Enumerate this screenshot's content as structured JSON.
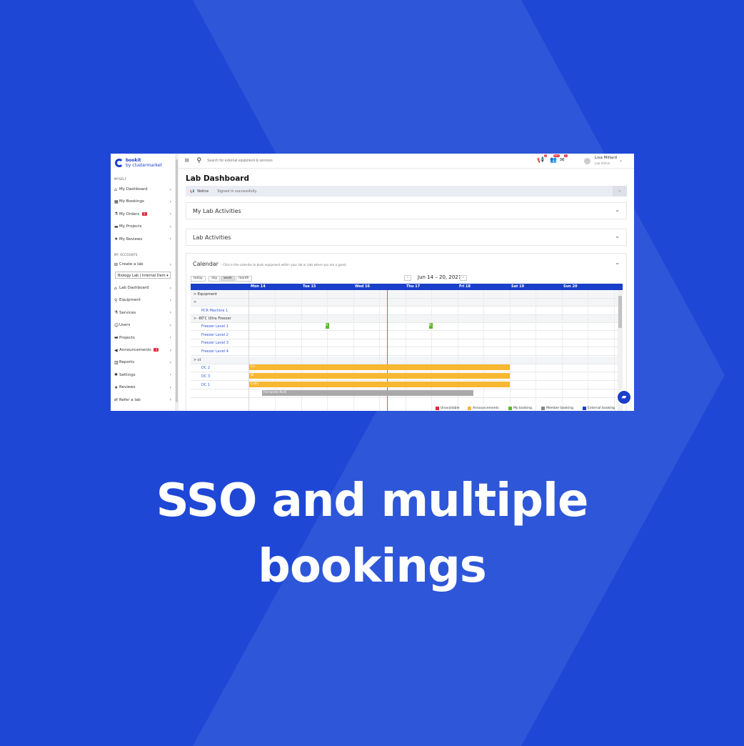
{
  "colors": {
    "background": "#1f47d6",
    "accent": "#1a3fc9",
    "orange": "#f7b731",
    "green": "#5cb82e",
    "red": "#e0293a",
    "grey": "#a9a9a9"
  },
  "headline": {
    "line1": "SSO and multiple",
    "line2": "bookings"
  },
  "app": {
    "logo": {
      "line1": "bookit",
      "line2": "by clustermarket"
    },
    "search": {
      "placeholder": "Search for external equipment & services"
    },
    "notifications": {
      "bell": "2",
      "users": "99+",
      "mail": "1"
    },
    "user": {
      "name": "Lisa Millard",
      "role": "Lab Admin"
    }
  },
  "sidebar": {
    "section_myself": "MYSELF",
    "myself_items": [
      {
        "label": "My Dashboard",
        "icon": "home-icon"
      },
      {
        "label": "My Bookings",
        "icon": "calendar-icon"
      },
      {
        "label": "My Orders",
        "icon": "flask-icon",
        "badge": "5"
      },
      {
        "label": "My Projects",
        "icon": "folder-icon"
      },
      {
        "label": "My Reviews",
        "icon": "star-icon"
      }
    ],
    "section_accounts": "MY ACCOUNTS",
    "create_lab": "Create a lab",
    "lab_select": "Biology Lab | Internal Dem",
    "lab_items": [
      {
        "label": "Lab Dashboard",
        "icon": "home-icon"
      },
      {
        "label": "Equipment",
        "icon": "microscope-icon"
      },
      {
        "label": "Services",
        "icon": "flask-icon"
      },
      {
        "label": "Users",
        "icon": "users-icon"
      },
      {
        "label": "Projects",
        "icon": "folder-icon"
      },
      {
        "label": "Announcements",
        "icon": "megaphone-icon",
        "badge": "3"
      },
      {
        "label": "Reports",
        "icon": "chart-icon"
      },
      {
        "label": "Settings",
        "icon": "gear-icon"
      },
      {
        "label": "Reviews",
        "icon": "star-icon"
      },
      {
        "label": "Refer a lab",
        "icon": "share-icon"
      }
    ]
  },
  "main": {
    "title": "Lab Dashboard",
    "notice": {
      "label": "Notice",
      "message": "Signed in successfully."
    },
    "panels": {
      "my_lab_activities": "My Lab Activities",
      "lab_activities": "Lab Activities",
      "calendar": "Calendar",
      "calendar_sub": "– Click in the calendar to book equipment within your lab or labs where you are a guest."
    },
    "calendar": {
      "today": "today",
      "day": "day",
      "week": "week",
      "month": "month",
      "range": "Jun 14 – 20, 2021",
      "days": [
        "Mon 14",
        "Tue 15",
        "Wed 16",
        "Thu 17",
        "Fri 18",
        "Sat 19",
        "Sun 20"
      ],
      "rows": [
        {
          "label": "> Equipment",
          "group": true
        },
        {
          "label": ">",
          "group": true
        },
        {
          "label": "PCR Machine 1",
          "group": false
        },
        {
          "label": "> -80 ̊C Ultra Freezer",
          "group": true
        },
        {
          "label": "Freezer Level 1",
          "group": false
        },
        {
          "label": "Freezer Level 2",
          "group": false
        },
        {
          "label": "Freezer Level 3",
          "group": false
        },
        {
          "label": "Freezer Level 4",
          "group": false
        },
        {
          "label": "> ct",
          "group": true
        },
        {
          "label": "DC 2",
          "group": false
        },
        {
          "label": "DC 3",
          "group": false
        },
        {
          "label": "DC 1",
          "group": false
        },
        {
          "label": "",
          "group": false
        }
      ],
      "events": {
        "dc2": "Co",
        "dc3": "Bi",
        "dc1": "Cells",
        "booking": "Fernando Redi",
        "f1a": "B",
        "f1b": "B"
      },
      "legend": [
        {
          "label": "Unavailable",
          "color": "#e0293a"
        },
        {
          "label": "Announcements",
          "color": "#f7b731"
        },
        {
          "label": "My booking",
          "color": "#5cb82e"
        },
        {
          "label": "Member booking",
          "color": "#888888"
        },
        {
          "label": "External booking",
          "color": "#1a3fc9"
        }
      ]
    }
  }
}
